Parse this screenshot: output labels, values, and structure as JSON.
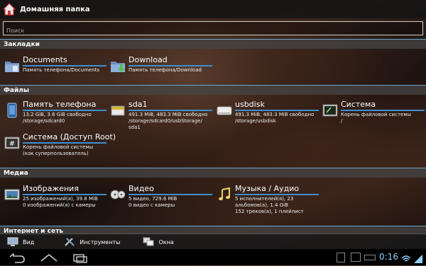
{
  "window": {
    "title": "Домашняя папка"
  },
  "search": {
    "placeholder": "Поиск"
  },
  "sections": {
    "bookmarks": "Закладки",
    "files": "Файлы",
    "media": "Медиа",
    "internet": "Интернет и сеть"
  },
  "bookmarks": [
    {
      "name": "Documents",
      "desc": "Память телефона/Documents",
      "icon": "folder-documents-icon"
    },
    {
      "name": "Download",
      "desc": "Память телефона/Download",
      "icon": "folder-download-icon"
    }
  ],
  "files": [
    {
      "name": "Память телефона",
      "desc1": "13.2 GiB, 3.6 GiB свободно",
      "desc2": "/storage/sdcard0",
      "desc3": "",
      "icon": "phone-storage-icon"
    },
    {
      "name": "sda1",
      "desc1": "491.3 MiB, 483.3 MiB свободно",
      "desc2": "/storage/sdcard0/usbStorage/",
      "desc3": "sda1",
      "icon": "sd-card-icon"
    },
    {
      "name": "usbdisk",
      "desc1": "491.3 MiB, 483.3 MiB свободно",
      "desc2": "/storage/usbdisk",
      "desc3": "",
      "icon": "usb-drive-icon"
    },
    {
      "name": "Система",
      "desc1": "Корень файловой системы",
      "desc2": "/",
      "desc3": "",
      "icon": "terminal-icon"
    },
    {
      "name": "Система (Доступ Root)",
      "desc1": "Корень файловой системы",
      "desc2": "(как суперпользователь)",
      "desc3": "",
      "icon": "root-hash-icon"
    }
  ],
  "media": [
    {
      "name": "Изображения",
      "desc1": "25 изображений(я), 39.8 MiB",
      "desc2": "0 изображений(я) с камеры",
      "desc3": "",
      "icon": "images-icon"
    },
    {
      "name": "Видео",
      "desc1": "5 видео, 729.6 MiB",
      "desc2": "0 видео с камеры",
      "desc3": "",
      "icon": "video-icon"
    },
    {
      "name": "Музыка / Аудио",
      "desc1": "5 исполнителей(я), 23",
      "desc2": "альбомов(а), 1.4 GiB",
      "desc3": "152 треков(а), 1 плейлист",
      "icon": "music-icon"
    }
  ],
  "toolbar": {
    "view": "Вид",
    "tools": "Инструменты",
    "windows": "Окна"
  },
  "status": {
    "time": "0:16"
  },
  "colors": {
    "accent": "#3f8fcf",
    "header_bg": "#464646"
  }
}
